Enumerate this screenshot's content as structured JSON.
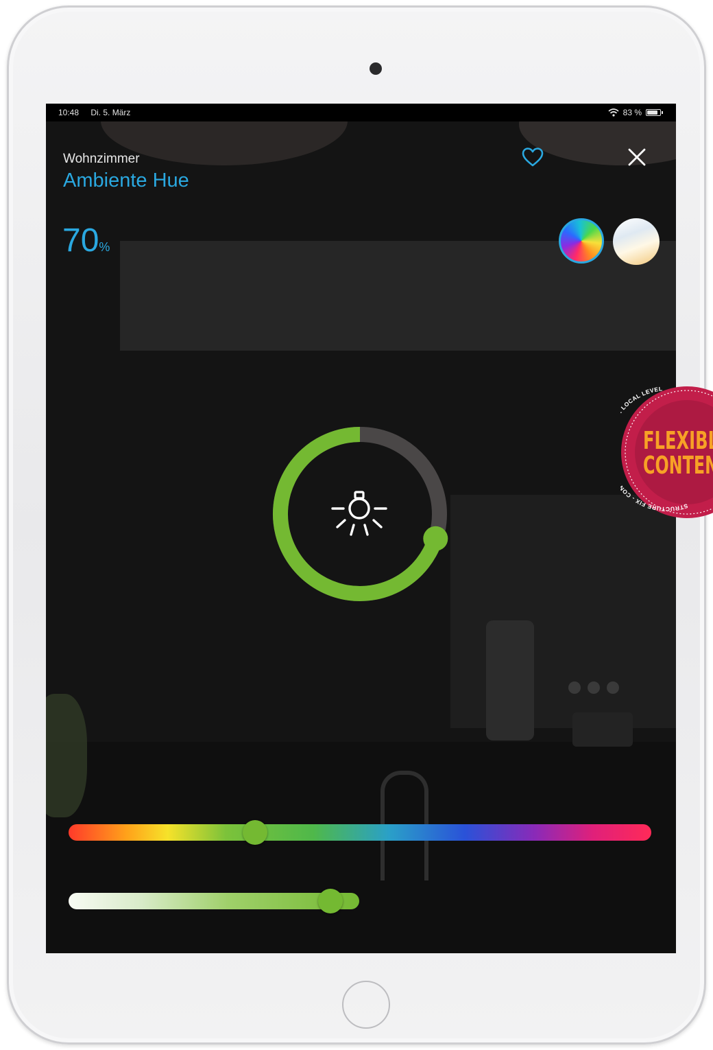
{
  "status_bar": {
    "time": "10:48",
    "date": "Di. 5. März",
    "battery_label": "83 %",
    "battery_level": 0.83
  },
  "header": {
    "room": "Wohnzimmer",
    "light": "Ambiente Hue"
  },
  "brightness": {
    "value": "70",
    "unit": "%",
    "level": 0.7
  },
  "modes": [
    {
      "name": "color",
      "selected": true
    },
    {
      "name": "white",
      "selected": false
    }
  ],
  "sliders": {
    "hue_position": 0.32,
    "white_position": 0.9
  },
  "badge": {
    "big_line1": "FLEXIBL",
    "big_line2": "CONTEN",
    "ring_text": "STRUCTURE FIX - CONTENT ADAPTEMBLE FOR LOCAL LEVEL"
  },
  "colors": {
    "accent": "#2aa8e0",
    "active_green": "#74b932",
    "inactive_ring": "#4a4747",
    "badge_red": "#c21e4a"
  },
  "icons": {
    "favorite": "heart-outline-icon",
    "close": "close-icon",
    "light": "lightbulb-rays-icon",
    "wifi": "wifi-icon",
    "battery": "battery-icon"
  }
}
